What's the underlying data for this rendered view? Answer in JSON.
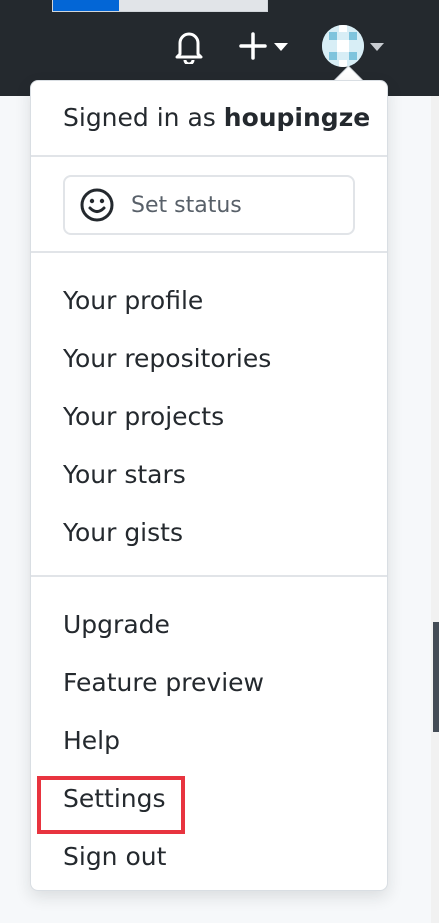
{
  "header": {
    "icons": [
      "bell-icon",
      "plus-icon",
      "avatar"
    ]
  },
  "menu": {
    "signed_in_prefix": "Signed in as ",
    "username": "houpingze",
    "set_status_label": "Set status",
    "group1": [
      "Your profile",
      "Your repositories",
      "Your projects",
      "Your stars",
      "Your gists"
    ],
    "group2": [
      "Upgrade",
      "Feature preview",
      "Help",
      "Settings",
      "Sign out"
    ]
  },
  "annotation": {
    "highlight_color": "#e8343f",
    "highlighted_item": "Settings"
  }
}
